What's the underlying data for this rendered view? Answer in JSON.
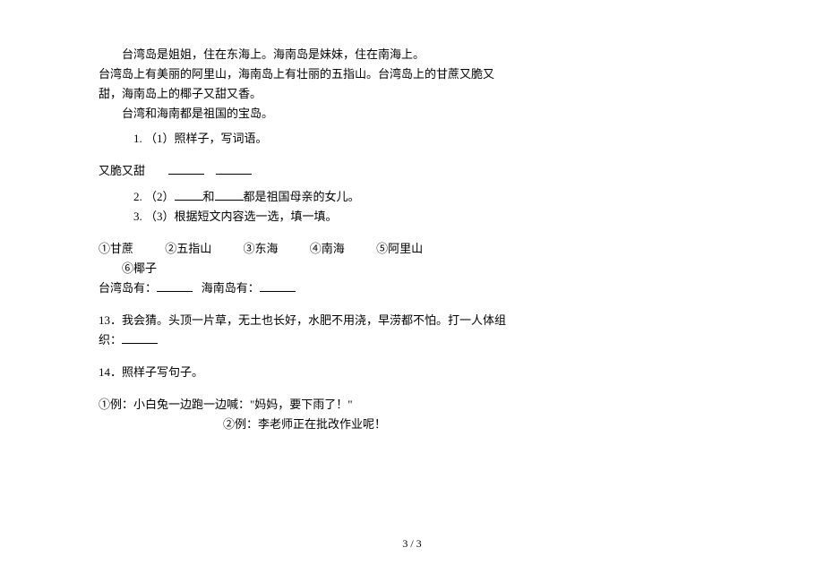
{
  "passage": {
    "line1": "台湾岛是姐姐，住在东海上。海南岛是妹妹，住在南海上。",
    "line2": "台湾岛上有美丽的阿里山，海南岛上有壮丽的五指山。台湾岛上的甘蔗又脆又甜，海南岛上的椰子又甜又香。",
    "line3": "台湾和海南都是祖国的宝岛。"
  },
  "q1": {
    "number": "1.",
    "label": "（1）照样子，写词语。",
    "example": "又脆又甜"
  },
  "q2": {
    "number": "2.",
    "label_prefix": "（2）",
    "label_mid": "和",
    "label_suffix": "都是祖国母亲的女儿。"
  },
  "q3": {
    "number": "3.",
    "label": "（3）根据短文内容选一选，填一填。"
  },
  "options": {
    "o1": "①甘蔗",
    "o2": "②五指山",
    "o3": "③东海",
    "o4": "④南海",
    "o5": "⑤阿里山",
    "o6": "⑥椰子"
  },
  "fill": {
    "taiwan": "台湾岛有：",
    "hainan": "海南岛有："
  },
  "q13": {
    "number": "13．",
    "text": "我会猜。头顶一片草，无土也长好，水肥不用浇，早涝都不怕。打一人体组织："
  },
  "q14": {
    "number": "14．",
    "label": "照样子写句子。",
    "ex1": "①例：小白兔一边跑一边喊：\"妈妈，要下雨了！\"",
    "ex2": "②例：李老师正在批改作业呢！"
  },
  "pageNumber": "3 / 3"
}
